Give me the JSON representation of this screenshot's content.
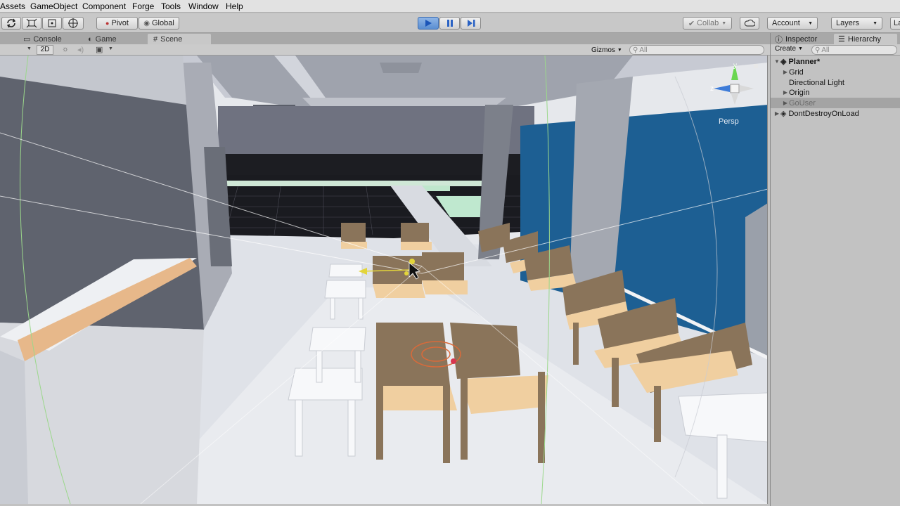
{
  "menu": [
    "Assets",
    "GameObject",
    "Component",
    "Forge",
    "Tools",
    "Window",
    "Help"
  ],
  "toolbar": {
    "pivot": "Pivot",
    "global": "Global",
    "collab": "Collab",
    "account": "Account",
    "layers": "Layers",
    "layout": "La"
  },
  "tabs": {
    "console": "Console",
    "game": "Game",
    "scene": "Scene"
  },
  "scene_bar": {
    "mode_2d": "2D",
    "gizmos": "Gizmos",
    "search_placeholder": "All"
  },
  "gizmo": {
    "y": "y",
    "z": "z",
    "projection": "Persp"
  },
  "right_tabs": {
    "inspector": "Inspector",
    "hierarchy": "Hierarchy"
  },
  "hierarchy": {
    "create": "Create",
    "search_placeholder": "All",
    "scene": "Planner*",
    "items": [
      "Grid",
      "Directional Light",
      "Origin",
      "GoUser"
    ],
    "dont_destroy": "DontDestroyOnLoad"
  },
  "colors": {
    "accent": "#3d7bd8",
    "chair_frame": "#8a745a",
    "chair_seat": "#f0cfa0",
    "window": "#1d5f93"
  }
}
